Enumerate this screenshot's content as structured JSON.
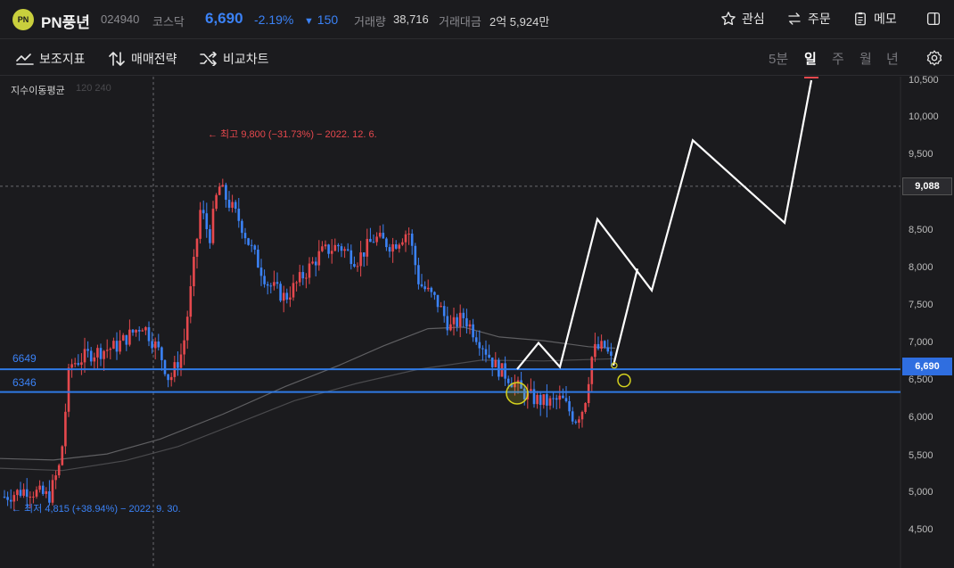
{
  "header": {
    "logo_text": "PN",
    "stock_name": "PN풍년",
    "code": "024940",
    "market": "코스닥",
    "price": "6,690",
    "change_pct": "-2.19%",
    "change_arrow": "▼",
    "change_amount": "150",
    "volume_label": "거래량",
    "volume_value": "38,716",
    "amount_label": "거래대금",
    "amount_value": "2억 5,924만",
    "watch_label": "관심",
    "order_label": "주문",
    "memo_label": "메모"
  },
  "toolbar": {
    "indicators_label": "보조지표",
    "strategy_label": "매매전략",
    "compare_label": "비교차트",
    "periods": [
      "5분",
      "일",
      "주",
      "월",
      "년"
    ],
    "active_period": "일"
  },
  "chart_data": {
    "type": "candlestick",
    "ma_label": "지수이동평균",
    "ma_params": "120 240",
    "y_ticks": [
      "10,500",
      "10,000",
      "9,500",
      "9,000",
      "8,500",
      "8,000",
      "7,500",
      "7,000",
      "6,500",
      "6,000",
      "5,500",
      "5,000",
      "4,500"
    ],
    "y_tick_values": [
      10500,
      10000,
      9500,
      9000,
      8500,
      8000,
      7500,
      7000,
      6500,
      6000,
      5500,
      5000,
      4500
    ],
    "crosshair_value": 9088,
    "crosshair_label": "9,088",
    "current_price_value": 6690,
    "current_price_label": "6,690",
    "horizontal_lines": [
      {
        "label": "6649",
        "value": 6649
      },
      {
        "label": "6346",
        "value": 6346
      }
    ],
    "high_annotation": "← 최고 9,800 (−31.73%) − 2022. 12. 6.",
    "low_annotation": "← 최저 4,815 (+38.94%) − 2022. 9. 30.",
    "high_value": 9800,
    "low_value": 4815,
    "forecast_path": [
      6649,
      7000,
      6680,
      8650,
      7700,
      9700,
      8600,
      10500
    ],
    "colors": {
      "up": "#e5484d",
      "down": "#3b82f6",
      "line": "#2f7ae5",
      "forecast": "#ffffff",
      "circle": "#d4d11e"
    }
  }
}
